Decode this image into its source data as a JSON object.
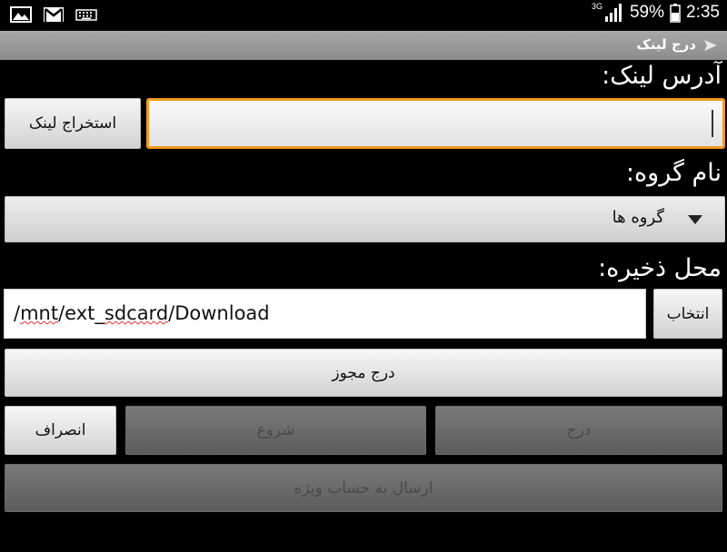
{
  "status_bar": {
    "left_icons": [
      "gallery-icon",
      "gmail-icon",
      "keyboard-icon"
    ],
    "network": "3G",
    "battery": "59%",
    "time": "2:35"
  },
  "title_bar": {
    "title": "درج لینک",
    "icon": "app-icon"
  },
  "link": {
    "label": "آدرس لینک:",
    "input_value": "",
    "extract_button": "استخراج لینک"
  },
  "group": {
    "label": "نام گروه:",
    "selected": "گروه ها"
  },
  "save_location": {
    "label": "محل ذخیره:",
    "path_parts": [
      "/",
      "mnt",
      "/ext_",
      "sdcard",
      "/Download"
    ],
    "choose_button": "انتخاب"
  },
  "buttons": {
    "insert_license": "درج مجوز",
    "cancel": "انصراف",
    "start": "شروع",
    "insert": "درج",
    "send_special_account": "ارسال به حساب ویژه"
  },
  "colors": {
    "focus_border": "#f19a1e",
    "spellcheck_underline": "#e03030"
  }
}
